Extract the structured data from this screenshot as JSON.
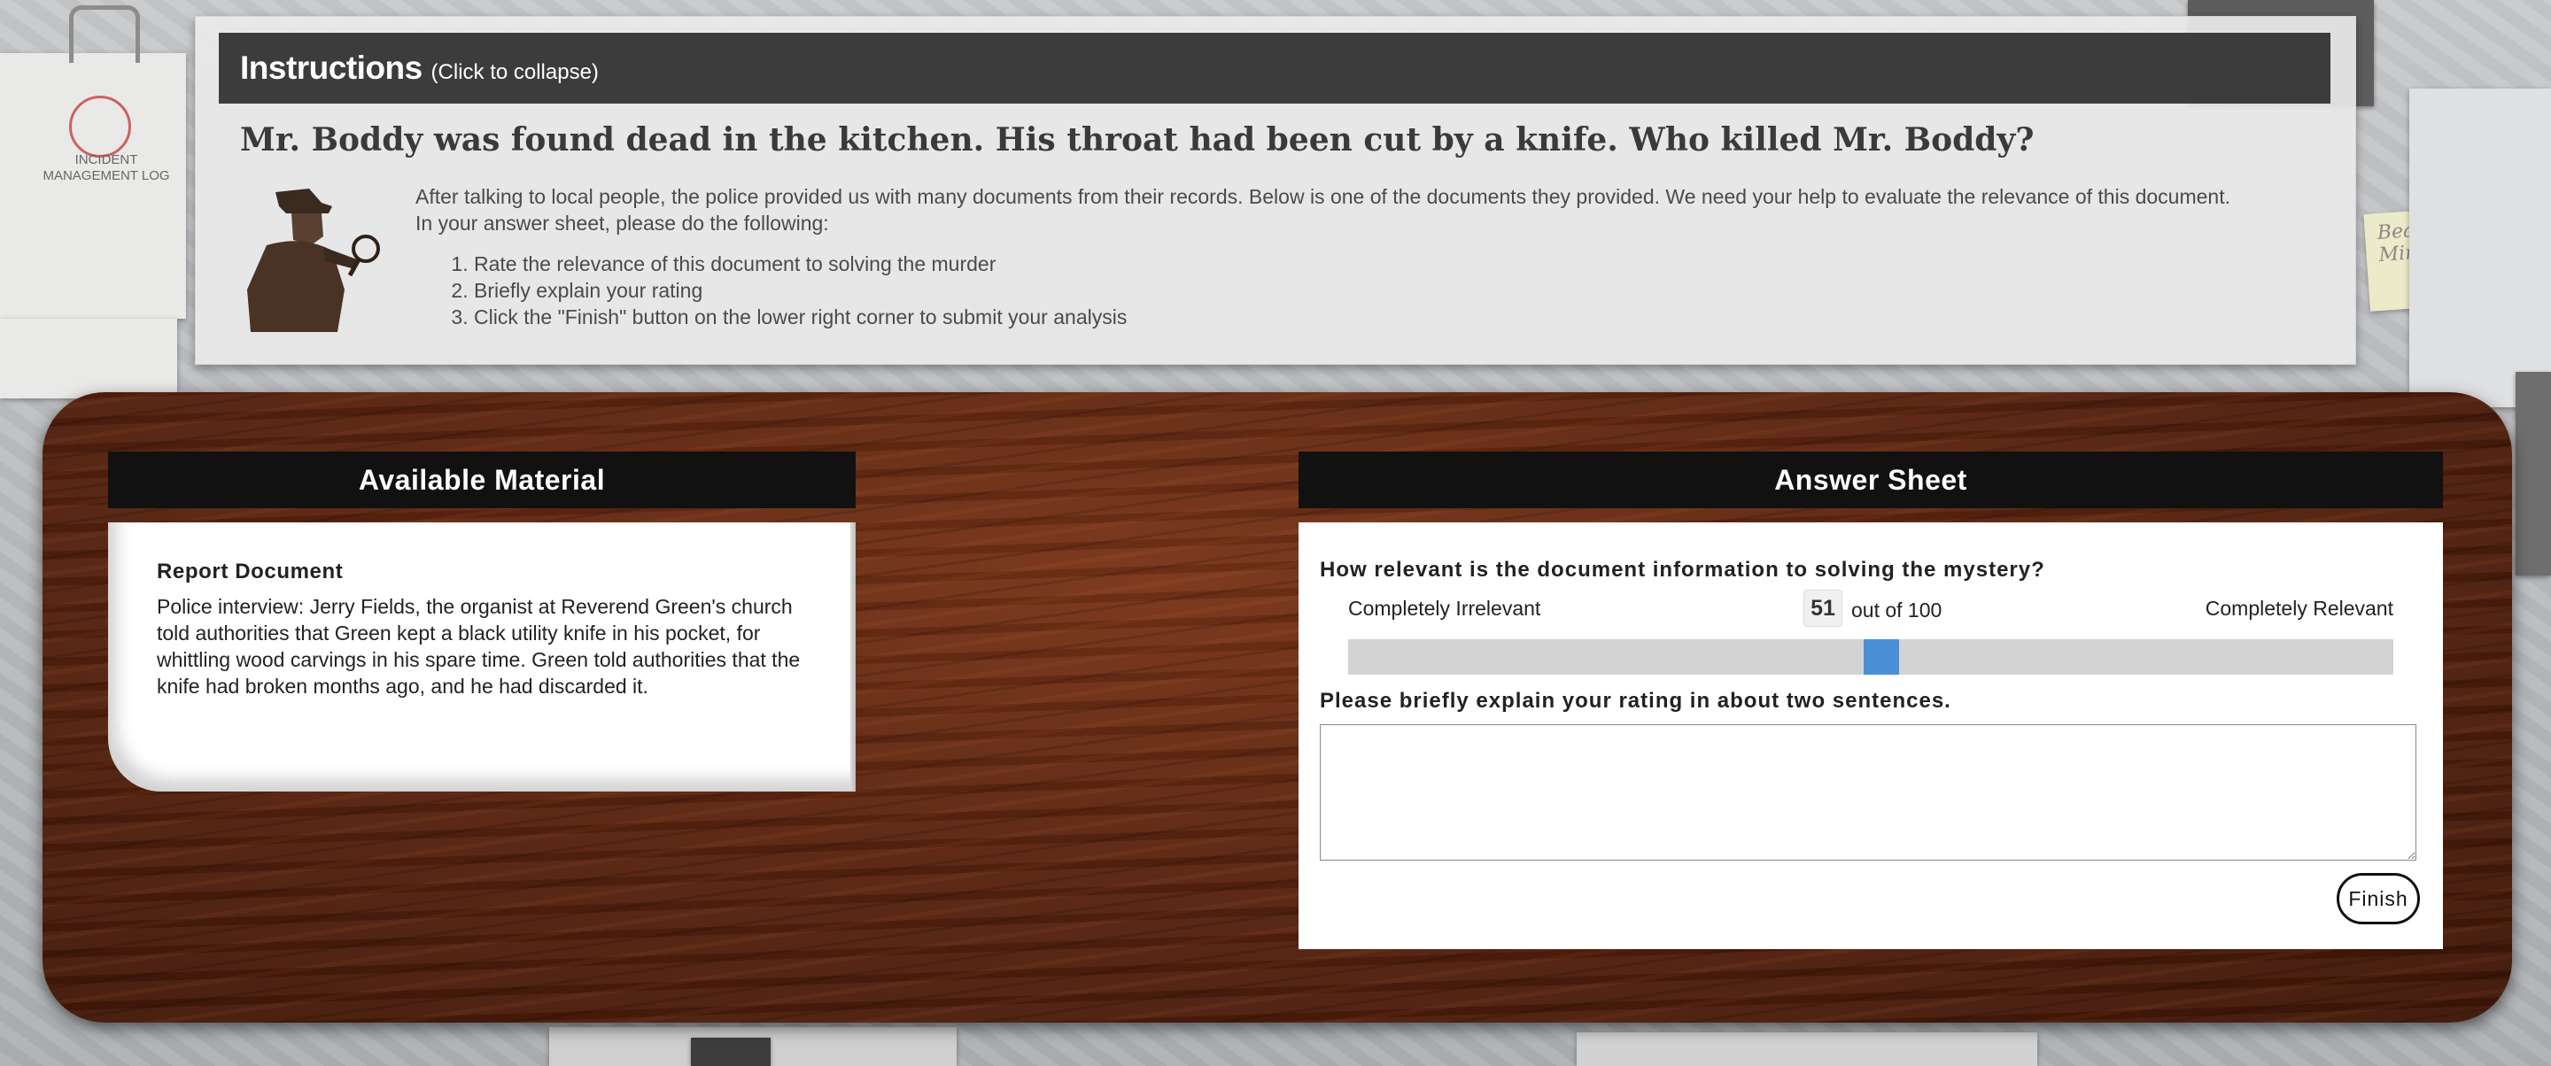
{
  "background": {
    "log_title": "INCIDENT\nMANAGEMENT LOG",
    "note_text": "Beautiful\nMind"
  },
  "instructions": {
    "title": "Instructions",
    "collapse_hint": "(Click to collapse)",
    "headline": "Mr. Boddy was found dead in the kitchen. His throat had been cut by a knife. Who killed Mr. Boddy?",
    "intro_line1": "After talking to local people, the police provided us with many documents from their records. Below is one of the documents they provided. We need your help to evaluate the relevance of this document.",
    "intro_line2": "In your answer sheet, please do the following:",
    "steps": [
      "Rate the relevance of this document to solving the murder",
      "Briefly explain your rating",
      "Click the \"Finish\" button on the lower right corner to submit your analysis"
    ]
  },
  "material": {
    "header": "Available Material",
    "doc_title": "Report Document",
    "doc_text": "Police interview: Jerry Fields, the organist at Reverend Green's church told authorities that Green kept a black utility knife in his pocket, for whittling wood carvings in his spare time. Green told authorities that the knife had broken months ago, and he had discarded it."
  },
  "answer": {
    "header": "Answer Sheet",
    "question1": "How relevant is the document information to solving the mystery?",
    "label_min": "Completely Irrelevant",
    "label_max": "Completely Relevant",
    "score": "51",
    "score_suffix": "out of 100",
    "slider_fraction": 0.51,
    "question2": "Please briefly explain your rating in about two sentences.",
    "explanation_value": "",
    "finish_label": "Finish"
  },
  "colors": {
    "slider_thumb": "#4a8fd6",
    "header_bg": "#111111",
    "desk_wood": "#5a2410"
  }
}
